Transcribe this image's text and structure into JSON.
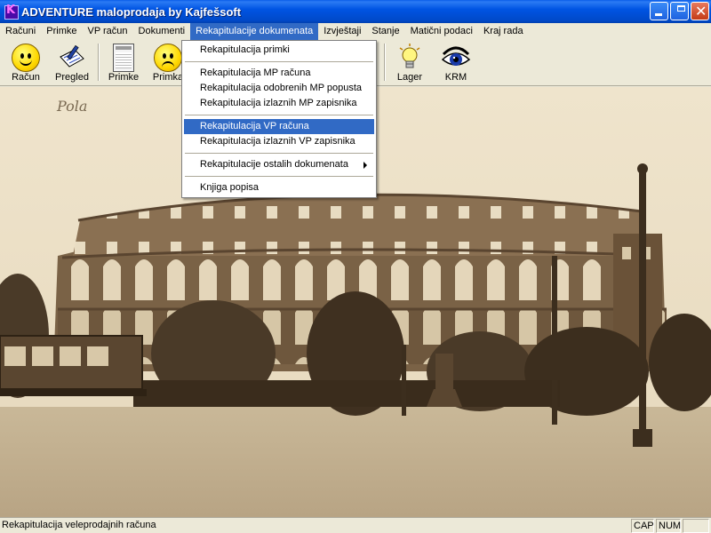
{
  "window": {
    "title": "ADVENTURE maloprodaja by Kajfešsoft",
    "icon": "app-k-icon"
  },
  "menubar": {
    "items": [
      {
        "label": "Računi"
      },
      {
        "label": "Primke"
      },
      {
        "label": "VP račun"
      },
      {
        "label": "Dokumenti"
      },
      {
        "label": "Rekapitulacije dokumenata",
        "active": true
      },
      {
        "label": "Izvještaji"
      },
      {
        "label": "Stanje"
      },
      {
        "label": "Matični podaci"
      },
      {
        "label": "Kraj rada"
      }
    ]
  },
  "toolbar": {
    "buttons": [
      {
        "label": "Račun",
        "icon": "smiley-happy-icon"
      },
      {
        "label": "Pregled",
        "icon": "pen-paper-icon"
      },
      {
        "label": "Primke",
        "icon": "document-icon"
      },
      {
        "label": "Primka",
        "icon": "smiley-sad-icon"
      },
      {
        "label": "Lager",
        "icon": "lightbulb-icon"
      },
      {
        "label": "KRM",
        "icon": "eye-icon"
      }
    ]
  },
  "dropdown": {
    "items": [
      {
        "label": "Rekapitulacija primki"
      },
      {
        "label": "Rekapitulacija MP računa"
      },
      {
        "label": "Rekapitulacija odobrenih MP popusta"
      },
      {
        "label": "Rekapitulacija izlaznih MP zapisnika"
      },
      {
        "label": "Rekapitulacija VP računa",
        "highlighted": true
      },
      {
        "label": "Rekapitulacija izlaznih VP zapisnika"
      },
      {
        "label": "Rekapitulacije ostalih dokumenata",
        "submenu": true
      },
      {
        "label": "Knjiga popisa"
      }
    ]
  },
  "background": {
    "caption": "Pola"
  },
  "statusbar": {
    "text": "Rekapitulacija veleprodajnih računa",
    "cap": "CAP",
    "num": "NUM"
  },
  "colors": {
    "titlebar": "#0054e3",
    "highlight": "#316ac5",
    "sepia": "#c9b898"
  }
}
